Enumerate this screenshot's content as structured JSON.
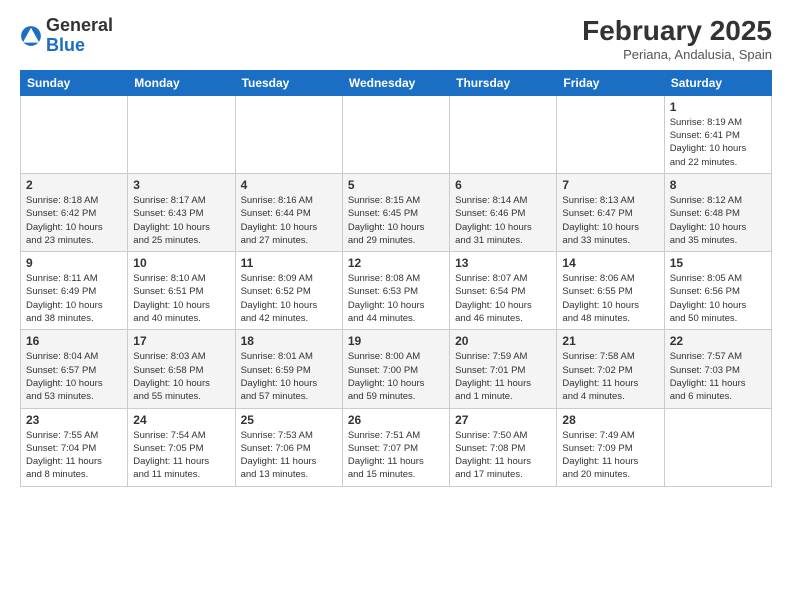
{
  "logo": {
    "general": "General",
    "blue": "Blue"
  },
  "header": {
    "month_year": "February 2025",
    "location": "Periana, Andalusia, Spain"
  },
  "days_of_week": [
    "Sunday",
    "Monday",
    "Tuesday",
    "Wednesday",
    "Thursday",
    "Friday",
    "Saturday"
  ],
  "weeks": [
    [
      {
        "day": "",
        "info": ""
      },
      {
        "day": "",
        "info": ""
      },
      {
        "day": "",
        "info": ""
      },
      {
        "day": "",
        "info": ""
      },
      {
        "day": "",
        "info": ""
      },
      {
        "day": "",
        "info": ""
      },
      {
        "day": "1",
        "info": "Sunrise: 8:19 AM\nSunset: 6:41 PM\nDaylight: 10 hours\nand 22 minutes."
      }
    ],
    [
      {
        "day": "2",
        "info": "Sunrise: 8:18 AM\nSunset: 6:42 PM\nDaylight: 10 hours\nand 23 minutes."
      },
      {
        "day": "3",
        "info": "Sunrise: 8:17 AM\nSunset: 6:43 PM\nDaylight: 10 hours\nand 25 minutes."
      },
      {
        "day": "4",
        "info": "Sunrise: 8:16 AM\nSunset: 6:44 PM\nDaylight: 10 hours\nand 27 minutes."
      },
      {
        "day": "5",
        "info": "Sunrise: 8:15 AM\nSunset: 6:45 PM\nDaylight: 10 hours\nand 29 minutes."
      },
      {
        "day": "6",
        "info": "Sunrise: 8:14 AM\nSunset: 6:46 PM\nDaylight: 10 hours\nand 31 minutes."
      },
      {
        "day": "7",
        "info": "Sunrise: 8:13 AM\nSunset: 6:47 PM\nDaylight: 10 hours\nand 33 minutes."
      },
      {
        "day": "8",
        "info": "Sunrise: 8:12 AM\nSunset: 6:48 PM\nDaylight: 10 hours\nand 35 minutes."
      }
    ],
    [
      {
        "day": "9",
        "info": "Sunrise: 8:11 AM\nSunset: 6:49 PM\nDaylight: 10 hours\nand 38 minutes."
      },
      {
        "day": "10",
        "info": "Sunrise: 8:10 AM\nSunset: 6:51 PM\nDaylight: 10 hours\nand 40 minutes."
      },
      {
        "day": "11",
        "info": "Sunrise: 8:09 AM\nSunset: 6:52 PM\nDaylight: 10 hours\nand 42 minutes."
      },
      {
        "day": "12",
        "info": "Sunrise: 8:08 AM\nSunset: 6:53 PM\nDaylight: 10 hours\nand 44 minutes."
      },
      {
        "day": "13",
        "info": "Sunrise: 8:07 AM\nSunset: 6:54 PM\nDaylight: 10 hours\nand 46 minutes."
      },
      {
        "day": "14",
        "info": "Sunrise: 8:06 AM\nSunset: 6:55 PM\nDaylight: 10 hours\nand 48 minutes."
      },
      {
        "day": "15",
        "info": "Sunrise: 8:05 AM\nSunset: 6:56 PM\nDaylight: 10 hours\nand 50 minutes."
      }
    ],
    [
      {
        "day": "16",
        "info": "Sunrise: 8:04 AM\nSunset: 6:57 PM\nDaylight: 10 hours\nand 53 minutes."
      },
      {
        "day": "17",
        "info": "Sunrise: 8:03 AM\nSunset: 6:58 PM\nDaylight: 10 hours\nand 55 minutes."
      },
      {
        "day": "18",
        "info": "Sunrise: 8:01 AM\nSunset: 6:59 PM\nDaylight: 10 hours\nand 57 minutes."
      },
      {
        "day": "19",
        "info": "Sunrise: 8:00 AM\nSunset: 7:00 PM\nDaylight: 10 hours\nand 59 minutes."
      },
      {
        "day": "20",
        "info": "Sunrise: 7:59 AM\nSunset: 7:01 PM\nDaylight: 11 hours\nand 1 minute."
      },
      {
        "day": "21",
        "info": "Sunrise: 7:58 AM\nSunset: 7:02 PM\nDaylight: 11 hours\nand 4 minutes."
      },
      {
        "day": "22",
        "info": "Sunrise: 7:57 AM\nSunset: 7:03 PM\nDaylight: 11 hours\nand 6 minutes."
      }
    ],
    [
      {
        "day": "23",
        "info": "Sunrise: 7:55 AM\nSunset: 7:04 PM\nDaylight: 11 hours\nand 8 minutes."
      },
      {
        "day": "24",
        "info": "Sunrise: 7:54 AM\nSunset: 7:05 PM\nDaylight: 11 hours\nand 11 minutes."
      },
      {
        "day": "25",
        "info": "Sunrise: 7:53 AM\nSunset: 7:06 PM\nDaylight: 11 hours\nand 13 minutes."
      },
      {
        "day": "26",
        "info": "Sunrise: 7:51 AM\nSunset: 7:07 PM\nDaylight: 11 hours\nand 15 minutes."
      },
      {
        "day": "27",
        "info": "Sunrise: 7:50 AM\nSunset: 7:08 PM\nDaylight: 11 hours\nand 17 minutes."
      },
      {
        "day": "28",
        "info": "Sunrise: 7:49 AM\nSunset: 7:09 PM\nDaylight: 11 hours\nand 20 minutes."
      },
      {
        "day": "",
        "info": ""
      }
    ]
  ]
}
